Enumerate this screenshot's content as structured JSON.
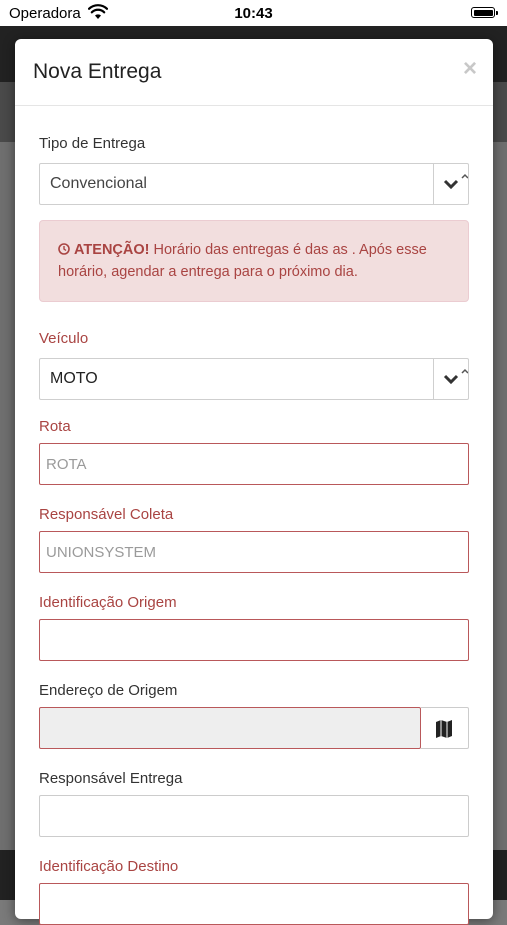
{
  "status_bar": {
    "carrier": "Operadora",
    "time": "10:43"
  },
  "modal": {
    "title": "Nova Entrega",
    "close_label": "×",
    "tipo_entrega": {
      "label": "Tipo de Entrega",
      "value": "Convencional"
    },
    "alert": {
      "title": "ATENÇÃO!",
      "message": "Horário das entregas é das as . Após esse horário, agendar a entrega para o próximo dia."
    },
    "veiculo": {
      "label": "Veículo",
      "value": "MOTO"
    },
    "rota": {
      "label": "Rota",
      "placeholder": "ROTA"
    },
    "responsavel_coleta": {
      "label": "Responsável Coleta",
      "placeholder": "UNIONSYSTEM"
    },
    "identificacao_origem": {
      "label": "Identificação Origem",
      "placeholder": ""
    },
    "endereco_origem": {
      "label": "Endereço de Origem",
      "placeholder": ""
    },
    "responsavel_entrega": {
      "label": "Responsável Entrega",
      "placeholder": ""
    },
    "identificacao_destino": {
      "label": "Identificação Destino",
      "placeholder": ""
    }
  },
  "colors": {
    "error": "#a94442",
    "alert_bg": "#f2dede",
    "error_border": "#b9585a"
  },
  "icons": [
    "wifi-icon",
    "battery-icon",
    "close-icon",
    "chevron-down-icon",
    "map-icon",
    "clock-icon"
  ]
}
